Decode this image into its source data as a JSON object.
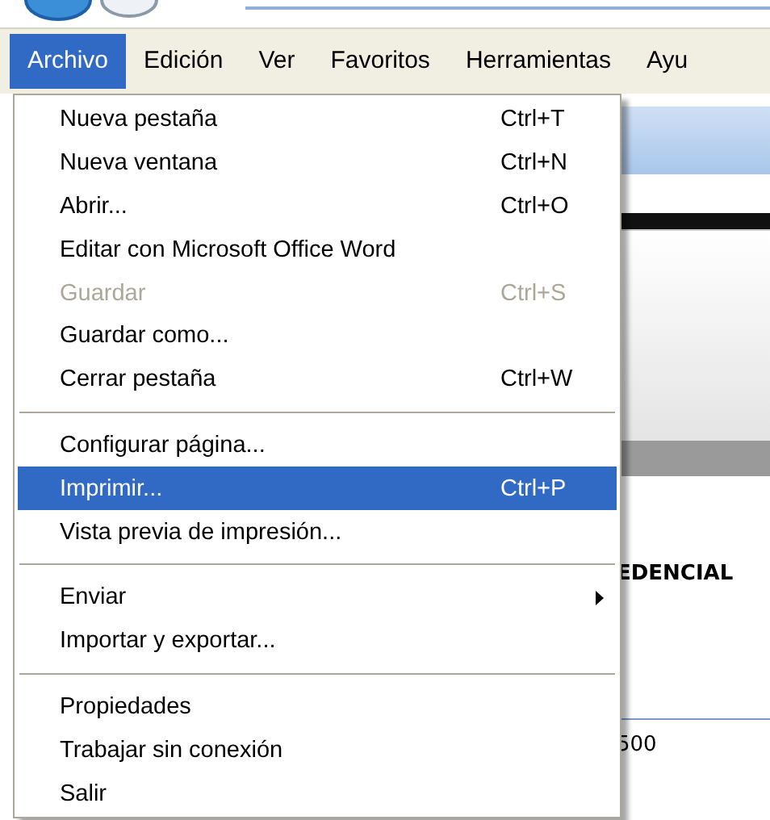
{
  "menu_bar": [
    {
      "label": "Archivo",
      "selected": true
    },
    {
      "label": "Edición",
      "selected": false
    },
    {
      "label": "Ver",
      "selected": false
    },
    {
      "label": "Favoritos",
      "selected": false
    },
    {
      "label": "Herramientas",
      "selected": false
    },
    {
      "label": "Ayu",
      "selected": false
    }
  ],
  "menu": [
    {
      "kind": "item",
      "label": "Nueva pestaña",
      "shortcut": "Ctrl+T",
      "disabled": false,
      "selected": false,
      "submenu": false
    },
    {
      "kind": "item",
      "label": "Nueva ventana",
      "shortcut": "Ctrl+N",
      "disabled": false,
      "selected": false,
      "submenu": false
    },
    {
      "kind": "item",
      "label": "Abrir...",
      "shortcut": "Ctrl+O",
      "disabled": false,
      "selected": false,
      "submenu": false
    },
    {
      "kind": "item",
      "label": "Editar con Microsoft Office Word",
      "disabled": false,
      "selected": false,
      "submenu": false
    },
    {
      "kind": "item",
      "label": "Guardar",
      "shortcut": "Ctrl+S",
      "disabled": true,
      "selected": false,
      "submenu": false
    },
    {
      "kind": "item",
      "label": "Guardar como...",
      "disabled": false,
      "selected": false,
      "submenu": false
    },
    {
      "kind": "item",
      "label": "Cerrar pestaña",
      "shortcut": "Ctrl+W",
      "disabled": false,
      "selected": false,
      "submenu": false
    },
    {
      "kind": "separator"
    },
    {
      "kind": "item",
      "label": "Configurar página...",
      "disabled": false,
      "selected": false,
      "submenu": false
    },
    {
      "kind": "item",
      "label": "Imprimir...",
      "shortcut": "Ctrl+P",
      "disabled": false,
      "selected": true,
      "submenu": false
    },
    {
      "kind": "item",
      "label": "Vista previa de impresión...",
      "disabled": false,
      "selected": false,
      "submenu": false
    },
    {
      "kind": "separator"
    },
    {
      "kind": "item",
      "label": "Enviar",
      "disabled": false,
      "selected": false,
      "submenu": true
    },
    {
      "kind": "item",
      "label": "Importar y exportar...",
      "disabled": false,
      "selected": false,
      "submenu": false
    },
    {
      "kind": "separator"
    },
    {
      "kind": "item",
      "label": "Propiedades",
      "disabled": false,
      "selected": false,
      "submenu": false
    },
    {
      "kind": "item",
      "label": "Trabajar sin conexión",
      "disabled": false,
      "selected": false,
      "submenu": false
    },
    {
      "kind": "item",
      "label": "Salir",
      "disabled": false,
      "selected": false,
      "submenu": false
    }
  ],
  "page_behind": {
    "heading": "EDENCIAL",
    "cell": "500"
  }
}
